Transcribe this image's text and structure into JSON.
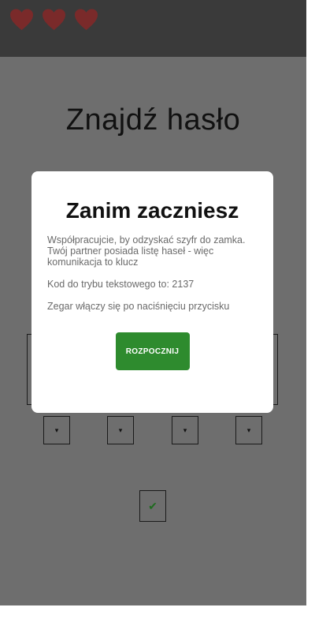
{
  "header": {
    "lives": [
      {
        "icon": "heart-icon"
      },
      {
        "icon": "heart-icon"
      },
      {
        "icon": "heart-icon"
      }
    ],
    "heart_color": "#7a2a2a"
  },
  "screen": {
    "title": "Znajdź hasło",
    "code_slots": 4,
    "dropdown_icon": "▾",
    "confirm_icon": "✔"
  },
  "dialog": {
    "title": "Zanim zaczniesz",
    "intro": "Współpracujcie, by odzyskać szyfr do zamka. Twój partner posiada listę haseł - więc komunikacja to klucz",
    "code_line": "Kod do trybu tekstowego to: 2137",
    "timer_line": "Zegar włączy się po naciśnięciu przycisku",
    "start_label": "ROZPOCZNIJ"
  },
  "colors": {
    "topbar": "#3a3a3a",
    "overlay": "#6e6e6e",
    "accent": "#2e8b2e"
  }
}
